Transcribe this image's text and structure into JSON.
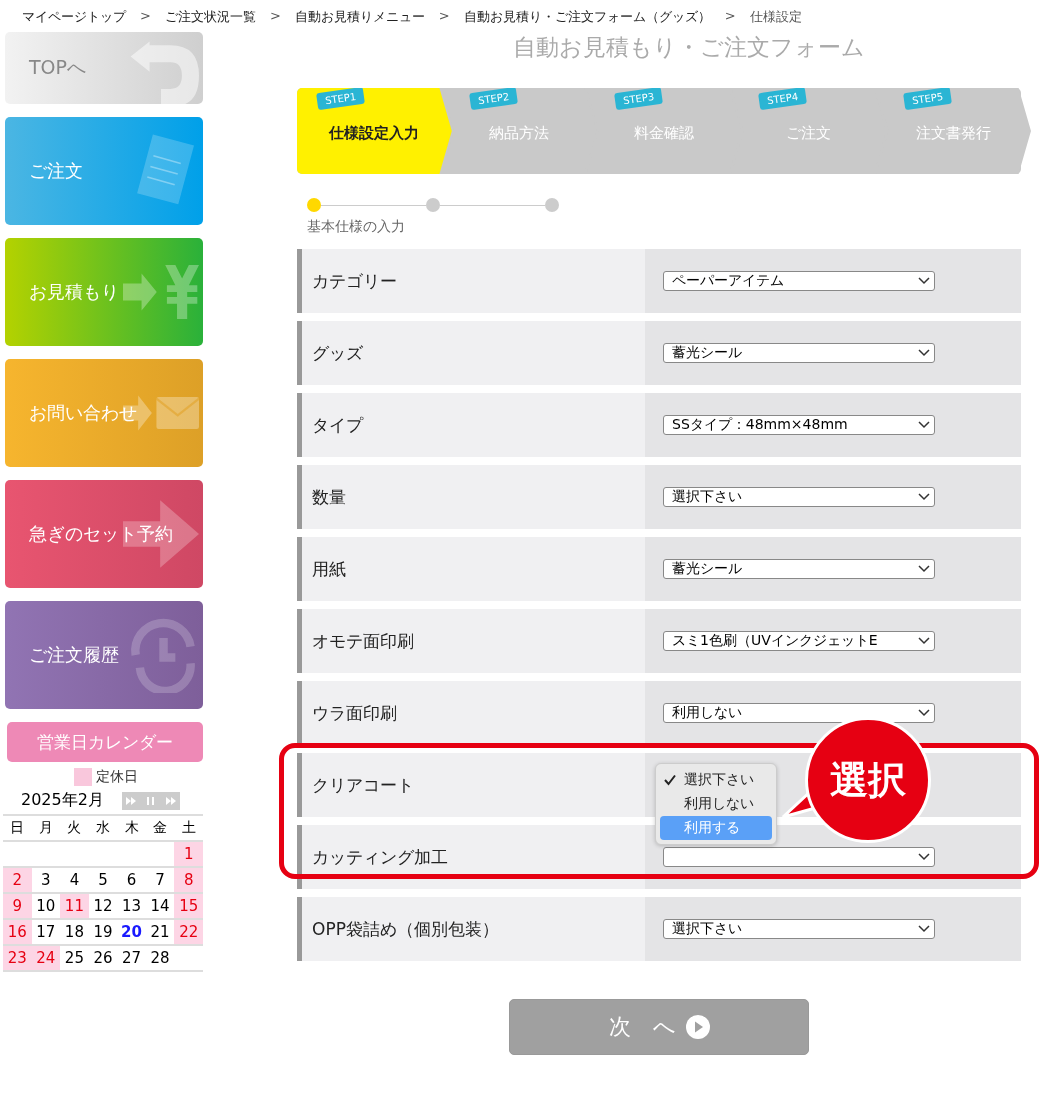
{
  "breadcrumb": [
    {
      "label": "マイページトップ",
      "link": true
    },
    {
      "label": "ご注文状況一覧",
      "link": true
    },
    {
      "label": "自動お見積りメニュー",
      "link": true
    },
    {
      "label": "自動お見積り・ご注文フォーム（グッズ）",
      "link": true
    },
    {
      "label": "仕様設定",
      "link": false
    }
  ],
  "breadcrumb_separator": ">",
  "sidebar": {
    "buttons": [
      {
        "label": "TOPへ",
        "kind": "top"
      },
      {
        "label": "ご注文",
        "kind": "order"
      },
      {
        "label": "お見積もり",
        "kind": "estimate"
      },
      {
        "label": "お問い合わせ",
        "kind": "contact"
      },
      {
        "label": "急ぎのセット予約",
        "kind": "rush"
      },
      {
        "label": "ご注文履歴",
        "kind": "history"
      }
    ],
    "calendar": {
      "title": "営業日カレンダー",
      "legend": "定休日",
      "month": "2025年2月",
      "weekdays": [
        "日",
        "月",
        "火",
        "水",
        "木",
        "金",
        "土"
      ],
      "weeks": [
        [
          {
            "kind": "empty"
          },
          {
            "kind": "empty"
          },
          {
            "kind": "empty"
          },
          {
            "kind": "empty"
          },
          {
            "kind": "empty"
          },
          {
            "kind": "empty"
          },
          {
            "day": "1",
            "kind": "holiday"
          }
        ],
        [
          {
            "day": "2",
            "kind": "holiday"
          },
          {
            "day": "3",
            "kind": "normal"
          },
          {
            "day": "4",
            "kind": "normal"
          },
          {
            "day": "5",
            "kind": "normal"
          },
          {
            "day": "6",
            "kind": "normal"
          },
          {
            "day": "7",
            "kind": "normal"
          },
          {
            "day": "8",
            "kind": "holiday"
          }
        ],
        [
          {
            "day": "9",
            "kind": "holiday"
          },
          {
            "day": "10",
            "kind": "normal"
          },
          {
            "day": "11",
            "kind": "holiday"
          },
          {
            "day": "12",
            "kind": "normal"
          },
          {
            "day": "13",
            "kind": "normal"
          },
          {
            "day": "14",
            "kind": "normal"
          },
          {
            "day": "15",
            "kind": "holiday"
          }
        ],
        [
          {
            "day": "16",
            "kind": "holiday"
          },
          {
            "day": "17",
            "kind": "normal"
          },
          {
            "day": "18",
            "kind": "normal"
          },
          {
            "day": "19",
            "kind": "normal"
          },
          {
            "day": "20",
            "kind": "today"
          },
          {
            "day": "21",
            "kind": "normal"
          },
          {
            "day": "22",
            "kind": "holiday"
          }
        ],
        [
          {
            "day": "23",
            "kind": "holiday"
          },
          {
            "day": "24",
            "kind": "holiday"
          },
          {
            "day": "25",
            "kind": "normal"
          },
          {
            "day": "26",
            "kind": "normal"
          },
          {
            "day": "27",
            "kind": "normal"
          },
          {
            "day": "28",
            "kind": "normal"
          },
          {
            "kind": "empty"
          }
        ]
      ]
    }
  },
  "title": "自動お見積もり・ご注文フォーム",
  "steps": [
    {
      "tag": "STEP1",
      "label": "仕様設定入力",
      "selected": true
    },
    {
      "tag": "STEP2",
      "label": "納品方法",
      "selected": false
    },
    {
      "tag": "STEP3",
      "label": "料金確認",
      "selected": false
    },
    {
      "tag": "STEP4",
      "label": "ご注文",
      "selected": false
    },
    {
      "tag": "STEP5",
      "label": "注文書発行",
      "selected": false
    }
  ],
  "progress": {
    "dots": [
      {
        "selected": true
      },
      {
        "selected": false
      },
      {
        "selected": false
      }
    ],
    "label": "基本仕様の入力"
  },
  "rows": [
    {
      "label": "カテゴリー",
      "value": "ペーパーアイテム"
    },
    {
      "label": "グッズ",
      "value": "蓄光シール"
    },
    {
      "label": "タイプ",
      "value": "SSタイプ：48mm×48mm"
    },
    {
      "label": "数量",
      "value": "選択下さい"
    },
    {
      "label": "用紙",
      "value": "蓄光シール"
    },
    {
      "label": "オモテ面印刷",
      "value": "スミ1色刷（UVインクジェットE"
    },
    {
      "label": "ウラ面印刷",
      "value": "利用しない"
    },
    {
      "label": "クリアコート",
      "dropdown": [
        {
          "label": "選択下さい",
          "checked": true,
          "highlighted": false
        },
        {
          "label": "利用しない",
          "checked": false,
          "highlighted": false
        },
        {
          "label": "利用する",
          "checked": false,
          "highlighted": true
        }
      ]
    },
    {
      "label": "カッティング加工"
    },
    {
      "label": "OPP袋詰め（個別包装）",
      "value": "選択下さい"
    }
  ],
  "callout": "選択",
  "next_button": "次　へ"
}
